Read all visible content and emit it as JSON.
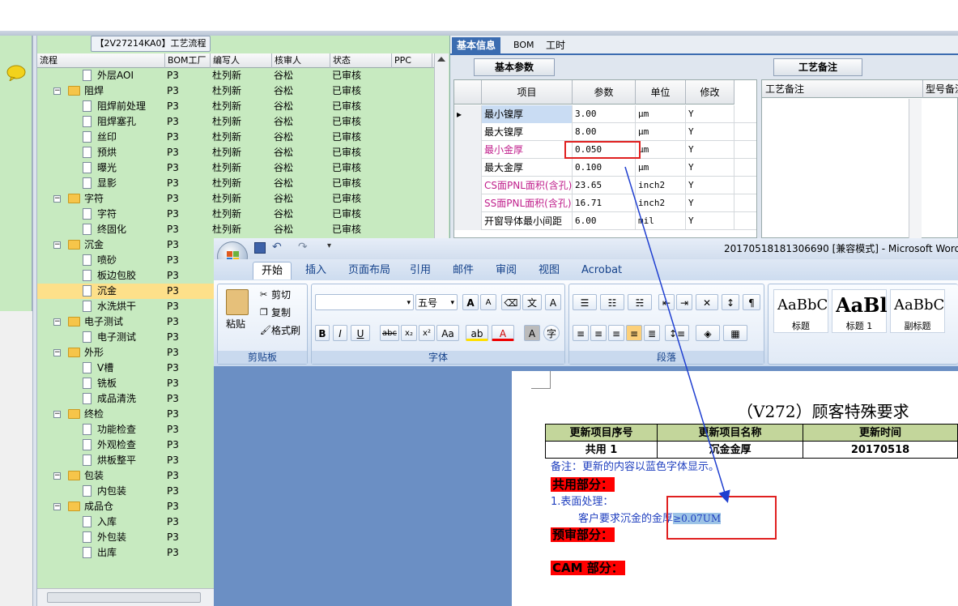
{
  "tree": {
    "title": "【2V27214KA0】工艺流程",
    "columns": [
      "流程",
      "BOM工厂",
      "编写人",
      "核审人",
      "状态",
      "PPC"
    ],
    "rows": [
      {
        "label": "外层AOI",
        "level": 2,
        "kind": "doc",
        "plant": "P3",
        "writer": "杜列新",
        "reviewer": "谷松",
        "status": "已审核"
      },
      {
        "label": "阻焊",
        "level": 1,
        "kind": "folder",
        "plant": "P3",
        "writer": "杜列新",
        "reviewer": "谷松",
        "status": "已审核"
      },
      {
        "label": "阻焊前处理",
        "level": 2,
        "kind": "doc",
        "plant": "P3",
        "writer": "杜列新",
        "reviewer": "谷松",
        "status": "已审核"
      },
      {
        "label": "阻焊塞孔",
        "level": 2,
        "kind": "doc",
        "plant": "P3",
        "writer": "杜列新",
        "reviewer": "谷松",
        "status": "已审核"
      },
      {
        "label": "丝印",
        "level": 2,
        "kind": "doc",
        "plant": "P3",
        "writer": "杜列新",
        "reviewer": "谷松",
        "status": "已审核"
      },
      {
        "label": "预烘",
        "level": 2,
        "kind": "doc",
        "plant": "P3",
        "writer": "杜列新",
        "reviewer": "谷松",
        "status": "已审核"
      },
      {
        "label": "曝光",
        "level": 2,
        "kind": "doc",
        "plant": "P3",
        "writer": "杜列新",
        "reviewer": "谷松",
        "status": "已审核"
      },
      {
        "label": "显影",
        "level": 2,
        "kind": "doc",
        "plant": "P3",
        "writer": "杜列新",
        "reviewer": "谷松",
        "status": "已审核"
      },
      {
        "label": "字符",
        "level": 1,
        "kind": "folder",
        "plant": "P3",
        "writer": "杜列新",
        "reviewer": "谷松",
        "status": "已审核"
      },
      {
        "label": "字符",
        "level": 2,
        "kind": "doc",
        "plant": "P3",
        "writer": "杜列新",
        "reviewer": "谷松",
        "status": "已审核"
      },
      {
        "label": "终固化",
        "level": 2,
        "kind": "doc",
        "plant": "P3",
        "writer": "杜列新",
        "reviewer": "谷松",
        "status": "已审核"
      },
      {
        "label": "沉金",
        "level": 1,
        "kind": "folder",
        "plant": "P3",
        "writer": "",
        "reviewer": "",
        "status": ""
      },
      {
        "label": "喷砂",
        "level": 2,
        "kind": "doc",
        "plant": "P3",
        "writer": "",
        "reviewer": "",
        "status": ""
      },
      {
        "label": "板边包胶",
        "level": 2,
        "kind": "doc",
        "plant": "P3",
        "writer": "",
        "reviewer": "",
        "status": ""
      },
      {
        "label": "沉金",
        "level": 2,
        "kind": "doc",
        "plant": "P3",
        "writer": "",
        "reviewer": "",
        "status": "",
        "selected": true
      },
      {
        "label": "水洗烘干",
        "level": 2,
        "kind": "doc",
        "plant": "P3",
        "writer": "",
        "reviewer": "",
        "status": ""
      },
      {
        "label": "电子测试",
        "level": 1,
        "kind": "folder",
        "plant": "P3",
        "writer": "",
        "reviewer": "",
        "status": ""
      },
      {
        "label": "电子测试",
        "level": 2,
        "kind": "doc",
        "plant": "P3",
        "writer": "",
        "reviewer": "",
        "status": ""
      },
      {
        "label": "外形",
        "level": 1,
        "kind": "folder",
        "plant": "P3",
        "writer": "",
        "reviewer": "",
        "status": ""
      },
      {
        "label": "V槽",
        "level": 2,
        "kind": "doc",
        "plant": "P3",
        "writer": "",
        "reviewer": "",
        "status": ""
      },
      {
        "label": "铣板",
        "level": 2,
        "kind": "doc",
        "plant": "P3",
        "writer": "",
        "reviewer": "",
        "status": ""
      },
      {
        "label": "成品清洗",
        "level": 2,
        "kind": "doc",
        "plant": "P3",
        "writer": "",
        "reviewer": "",
        "status": ""
      },
      {
        "label": "终检",
        "level": 1,
        "kind": "folder",
        "plant": "P3",
        "writer": "",
        "reviewer": "",
        "status": ""
      },
      {
        "label": "功能检查",
        "level": 2,
        "kind": "doc",
        "plant": "P3",
        "writer": "",
        "reviewer": "",
        "status": ""
      },
      {
        "label": "外观检查",
        "level": 2,
        "kind": "doc",
        "plant": "P3",
        "writer": "",
        "reviewer": "",
        "status": ""
      },
      {
        "label": "烘板整平",
        "level": 2,
        "kind": "doc",
        "plant": "P3",
        "writer": "",
        "reviewer": "",
        "status": ""
      },
      {
        "label": "包装",
        "level": 1,
        "kind": "folder",
        "plant": "P3",
        "writer": "",
        "reviewer": "",
        "status": ""
      },
      {
        "label": "内包装",
        "level": 2,
        "kind": "doc",
        "plant": "P3",
        "writer": "",
        "reviewer": "",
        "status": ""
      },
      {
        "label": "成品仓",
        "level": 1,
        "kind": "folder",
        "plant": "P3",
        "writer": "",
        "reviewer": "",
        "status": ""
      },
      {
        "label": "入库",
        "level": 2,
        "kind": "doc",
        "plant": "P3",
        "writer": "",
        "reviewer": "",
        "status": ""
      },
      {
        "label": "外包装",
        "level": 2,
        "kind": "doc",
        "plant": "P3",
        "writer": "",
        "reviewer": "",
        "status": ""
      },
      {
        "label": "出库",
        "level": 2,
        "kind": "doc",
        "plant": "P3",
        "writer": "",
        "reviewer": "",
        "status": ""
      }
    ]
  },
  "right": {
    "tabs": [
      "基本信息",
      "BOM",
      "工时"
    ],
    "sub_tab": "基本参数",
    "notes_tab": "工艺备注",
    "notes_cols": [
      "工艺备注",
      "型号备注"
    ],
    "grid_cols": [
      "项目",
      "参数",
      "单位",
      "修改"
    ],
    "grid_rows": [
      {
        "item": "最小镍厚",
        "value": "3.00",
        "unit": "μm",
        "edit": "Y",
        "pink": false,
        "current": true
      },
      {
        "item": "最大镍厚",
        "value": "8.00",
        "unit": "μm",
        "edit": "Y",
        "pink": false
      },
      {
        "item": "最小金厚",
        "value": "0.050",
        "unit": "μm",
        "edit": "Y",
        "pink": true
      },
      {
        "item": "最大金厚",
        "value": "0.100",
        "unit": "μm",
        "edit": "Y",
        "pink": false
      },
      {
        "item": "CS面PNL面积(含孔)",
        "value": "23.65",
        "unit": "inch2",
        "edit": "Y",
        "pink": true
      },
      {
        "item": "SS面PNL面积(含孔)",
        "value": "16.71",
        "unit": "inch2",
        "edit": "Y",
        "pink": true
      },
      {
        "item": "开窗导体最小间距",
        "value": "6.00",
        "unit": "mil",
        "edit": "Y",
        "pink": false
      }
    ]
  },
  "word": {
    "title": "20170518181306690 [兼容模式] - Microsoft Word",
    "tabs": [
      "开始",
      "插入",
      "页面布局",
      "引用",
      "邮件",
      "审阅",
      "视图",
      "Acrobat"
    ],
    "clipboard": {
      "paste": "粘贴",
      "cut": "剪切",
      "copy": "复制",
      "format": "格式刷",
      "label": "剪贴板"
    },
    "font": {
      "size": "五号",
      "label": "字体"
    },
    "paragraph_label": "段落",
    "styles": [
      {
        "preview": "AaBbC",
        "name": "标题"
      },
      {
        "preview": "AaBl",
        "name": "标题 1"
      },
      {
        "preview": "AaBbC",
        "name": "副标题"
      }
    ],
    "doc": {
      "heading": "（V272）顾客特殊要求",
      "table_head": [
        "更新项目序号",
        "更新项目名称",
        "更新时间"
      ],
      "table_row": [
        "共用 1",
        "沉金金厚",
        "20170518"
      ],
      "note": "备注：更新的内容以蓝色字体显示。",
      "section1": "共用部分：",
      "item1": "1.表面处理：",
      "req_prefix": "客户要求沉金的金厚",
      "req_value": "≥0.07UM",
      "section2": "预审部分：",
      "section3": "CAM 部分："
    }
  },
  "colors": {
    "accent": "#3b6cb0",
    "tree_bg": "#c7eac0",
    "callout": "#e02020",
    "arrow": "#1f3fd0",
    "pink_text": "#c0208c"
  }
}
